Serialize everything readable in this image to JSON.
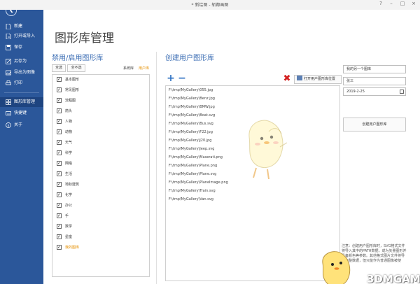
{
  "window": {
    "title": "* 新绘图 - 斩都画图",
    "controls": [
      "?",
      "–",
      "□",
      "×"
    ]
  },
  "sidebar": {
    "back_icon": "back-arrow-icon",
    "items": [
      {
        "label": "新建",
        "icon": "new-file-icon"
      },
      {
        "label": "打开或导入",
        "icon": "open-file-icon"
      },
      {
        "label": "保存",
        "icon": "save-icon"
      },
      {
        "label": "另存为",
        "icon": "save-as-icon"
      },
      {
        "label": "导出为图像",
        "icon": "export-image-icon"
      },
      {
        "label": "打印",
        "icon": "print-icon"
      },
      {
        "label": "图形库管理",
        "icon": "library-icon",
        "active": true
      },
      {
        "label": "快捷键",
        "icon": "keyboard-icon"
      },
      {
        "label": "关于",
        "icon": "info-icon"
      }
    ]
  },
  "main": {
    "page_title": "图形库管理",
    "library_section": {
      "title": "禁用/启用图形库",
      "select_all": "全选",
      "select_none": "全不选",
      "filter_system": "系统库",
      "filter_user": "用户库",
      "items": [
        {
          "name": "基本图形",
          "checked": true,
          "highlight": false
        },
        {
          "name": "常见图形",
          "checked": true,
          "highlight": false
        },
        {
          "name": "流程图",
          "checked": true,
          "highlight": false
        },
        {
          "name": "箭头",
          "checked": true,
          "highlight": false
        },
        {
          "name": "人物",
          "checked": true,
          "highlight": false
        },
        {
          "name": "动物",
          "checked": true,
          "highlight": false
        },
        {
          "name": "天气",
          "checked": true,
          "highlight": false
        },
        {
          "name": "科学",
          "checked": true,
          "highlight": false
        },
        {
          "name": "网络",
          "checked": true,
          "highlight": false
        },
        {
          "name": "生活",
          "checked": true,
          "highlight": false
        },
        {
          "name": "地标建筑",
          "checked": true,
          "highlight": false
        },
        {
          "name": "化学",
          "checked": true,
          "highlight": false
        },
        {
          "name": "办公",
          "checked": true,
          "highlight": false
        },
        {
          "name": "手",
          "checked": true,
          "highlight": false
        },
        {
          "name": "数学",
          "checked": true,
          "highlight": false
        },
        {
          "name": "星座",
          "checked": true,
          "highlight": false
        },
        {
          "name": "我的图库",
          "checked": true,
          "highlight": true
        }
      ]
    },
    "gallery_section": {
      "title": "创建用户图形库",
      "add_icon": "plus-icon",
      "remove_icon": "minus-icon",
      "delete_icon": "red-x-icon",
      "open_location_label": "打开用户图形库位置",
      "files": [
        "F:\\tmp\\MyGallery\\055.jpg",
        "F:\\tmp\\MyGallery\\Benz.jpg",
        "F:\\tmp\\MyGallery\\BMW.jpg",
        "F:\\tmp\\MyGallery\\Boat.svg",
        "F:\\tmp\\MyGallery\\Bus.svg",
        "F:\\tmp\\MyGallery\\F22.jpg",
        "F:\\tmp\\MyGallery\\J20.jpg",
        "F:\\tmp\\MyGallery\\Jeep.svg",
        "F:\\tmp\\MyGallery\\Maserati.png",
        "F:\\tmp\\MyGallery\\Plane.png",
        "F:\\tmp\\MyGallery\\Plane.svg",
        "F:\\tmp\\MyGallery\\PlaneImage.png",
        "F:\\tmp\\MyGallery\\Train.svg",
        "F:\\tmp\\MyGallery\\Van.svg"
      ],
      "name_value": "我的另一个图库",
      "author_value": "张三",
      "date_value": "2019-2-25",
      "create_button": "创建用户图形库",
      "note": "注意：创建用户图形库时，SVG格式文件将导入其中的PATH数据，成为矢量图形并具备颜色等参数。其他格式图片文件将导入完整数据，但只能作为普通图像被使用。"
    }
  },
  "watermark": "3DMGAME"
}
